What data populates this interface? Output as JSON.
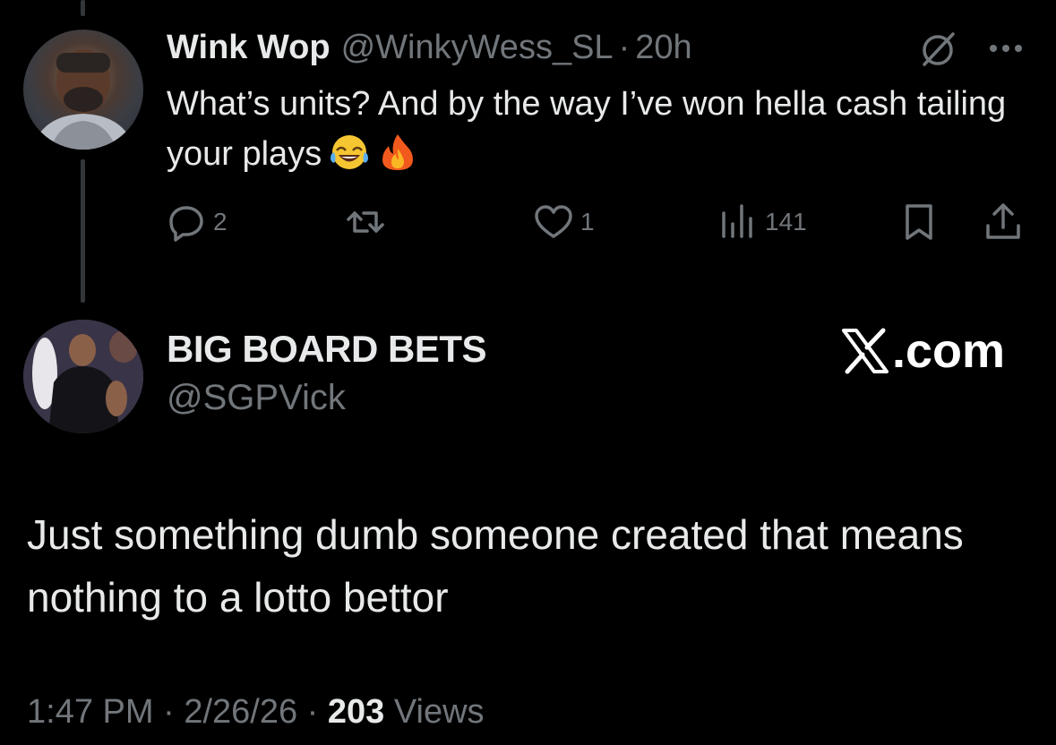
{
  "reply": {
    "author_name": "Wink Wop",
    "author_handle": "@WinkyWess_SL",
    "separator": "·",
    "time": "20h",
    "text": "What’s units? And by the way I’ve won hella cash tailing your plays",
    "emojis": [
      "laughing-with-tears-emoji",
      "fire-emoji"
    ],
    "actions": {
      "replies": "2",
      "reposts": "",
      "likes": "1",
      "views": "141"
    },
    "icons": {
      "grok": "grok-icon",
      "more": "more-icon",
      "reply": "reply-icon",
      "repost": "repost-icon",
      "like": "heart-icon",
      "views": "views-icon",
      "bookmark": "bookmark-icon",
      "share": "share-icon"
    }
  },
  "main": {
    "author_name": "BIG BOARD BETS",
    "author_handle": "@SGPVick",
    "watermark": ".com",
    "text": "Just something dumb someone created that means nothing to a lotto bettor",
    "time": "1:47 PM",
    "date": "2/26/26",
    "separator": "·",
    "views_count": "203",
    "views_label": "Views"
  },
  "colors": {
    "background": "#000000",
    "primary_text": "#e7e9ea",
    "secondary_text": "#71767b",
    "thread_line": "#333639"
  }
}
